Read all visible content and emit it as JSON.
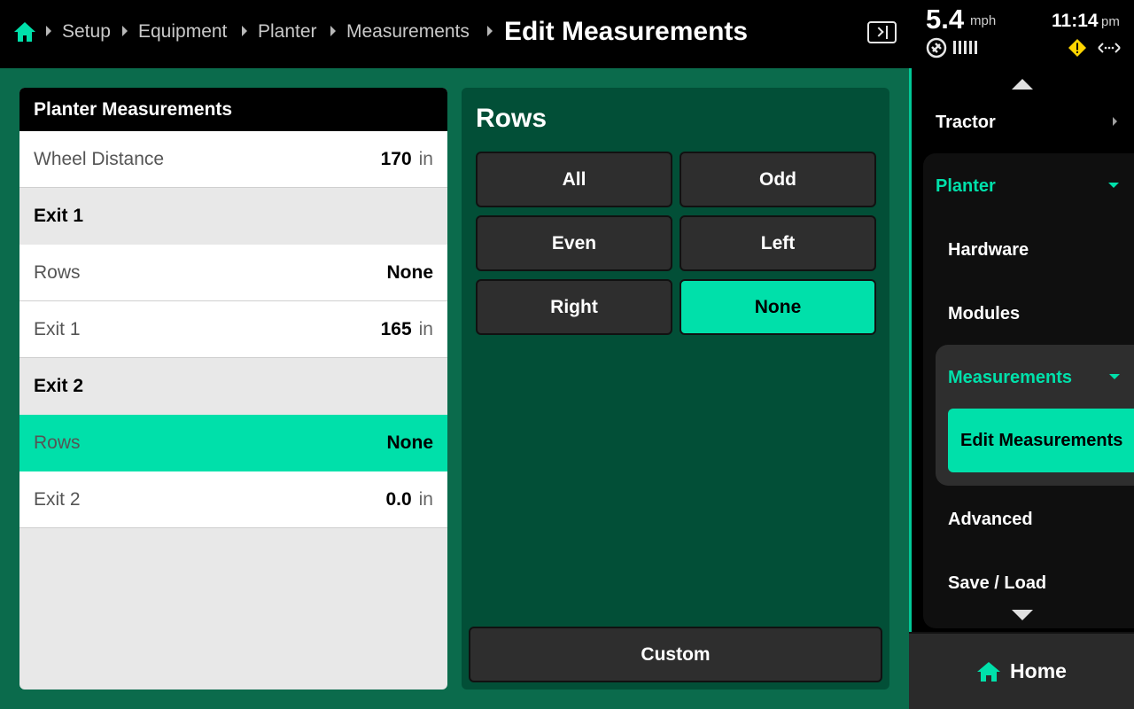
{
  "header": {
    "breadcrumb": [
      "Setup",
      "Equipment",
      "Planter",
      "Measurements"
    ],
    "title": "Edit Measurements",
    "speed": "5.4",
    "speed_unit": "mph",
    "time": "11:14",
    "ampm": "pm"
  },
  "planter_measurements": {
    "title": "Planter Measurements",
    "wheel_distance": {
      "label": "Wheel Distance",
      "value": "170",
      "unit": "in"
    },
    "exit1": {
      "section": "Exit 1",
      "rows": {
        "label": "Rows",
        "value": "None"
      },
      "distance": {
        "label": "Exit 1",
        "value": "165",
        "unit": "in"
      }
    },
    "exit2": {
      "section": "Exit 2",
      "rows": {
        "label": "Rows",
        "value": "None"
      },
      "distance": {
        "label": "Exit 2",
        "value": "0.0",
        "unit": "in"
      }
    }
  },
  "rows_panel": {
    "title": "Rows",
    "options": [
      "All",
      "Odd",
      "Even",
      "Left",
      "Right",
      "None"
    ],
    "selected": "None",
    "custom_label": "Custom"
  },
  "nav": {
    "tractor": "Tractor",
    "planter": "Planter",
    "hardware": "Hardware",
    "modules": "Modules",
    "measurements": "Measurements",
    "edit_measurements": "Edit Measurements",
    "advanced": "Advanced",
    "save_load": "Save / Load"
  },
  "home_label": "Home",
  "colors": {
    "accent": "#00e0aa",
    "background": "#0b6b4c",
    "panel": "#024f37"
  }
}
